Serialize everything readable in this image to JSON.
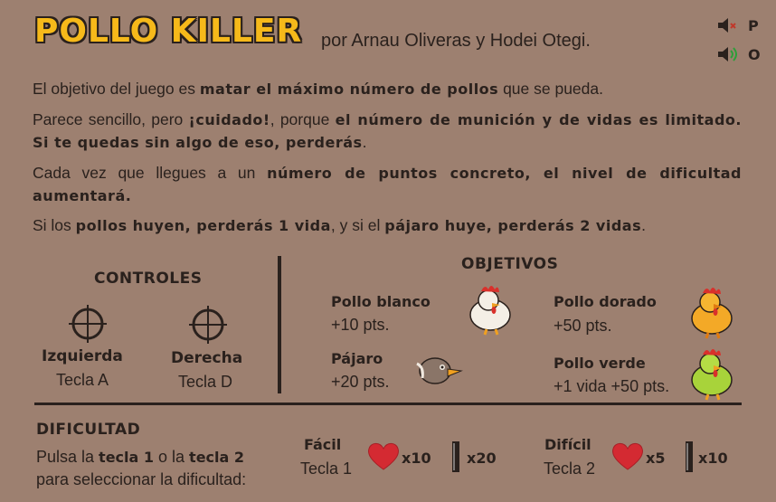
{
  "header": {
    "title": "POLLO KILLER",
    "byline": "por Arnau Oliveras y Hodei Otegi.",
    "mute_key": "P",
    "sound_key": "O"
  },
  "intro": {
    "p1": [
      {
        "text": "El objetivo del juego es ",
        "bold": false
      },
      {
        "text": "matar el máximo número de pollos",
        "bold": true
      },
      {
        "text": " que se pueda.",
        "bold": false
      }
    ],
    "p2": [
      {
        "text": "Parece sencillo, pero ",
        "bold": false
      },
      {
        "text": "¡cuidado!",
        "bold": true
      },
      {
        "text": ", porque ",
        "bold": false
      },
      {
        "text": "el número de munición y de vidas es limitado. Si te quedas sin algo de eso, perderás",
        "bold": true
      },
      {
        "text": ".",
        "bold": false
      }
    ],
    "p3": [
      {
        "text": "Cada vez que llegues a un ",
        "bold": false
      },
      {
        "text": "número de puntos concreto, el nivel de dificultad aumentará.",
        "bold": true
      }
    ],
    "p4": [
      {
        "text": "Si los ",
        "bold": false
      },
      {
        "text": "pollos huyen, perderás 1 vida",
        "bold": true
      },
      {
        "text": ", y si el ",
        "bold": false
      },
      {
        "text": "pájaro huye, perderás 2 vidas",
        "bold": true
      },
      {
        "text": ".",
        "bold": false
      }
    ]
  },
  "controls": {
    "heading": "CONTROLES",
    "left": {
      "label": "Izquierda",
      "key": "Tecla A"
    },
    "right": {
      "label": "Derecha",
      "key": "Tecla D"
    }
  },
  "objectives": {
    "heading": "OBJETIVOS",
    "white": {
      "name": "Pollo blanco",
      "points": "+10 pts."
    },
    "golden": {
      "name": "Pollo dorado",
      "points": "+50 pts."
    },
    "bird": {
      "name": "Pájaro",
      "points": "+20 pts."
    },
    "green": {
      "name": "Pollo verde",
      "points": "+1 vida +50 pts."
    }
  },
  "difficulty": {
    "heading": "DIFICULTAD",
    "instr_prefix": "Pulsa la ",
    "instr_key1": "tecla 1",
    "instr_mid": " o la ",
    "instr_key2": "tecla 2",
    "instr_line2": "para seleccionar la dificultad:",
    "easy": {
      "label": "Fácil",
      "key": "Tecla 1",
      "lives": "x10",
      "ammo": "x20"
    },
    "hard": {
      "label": "Difícil",
      "key": "Tecla 2",
      "lives": "x5",
      "ammo": "x10"
    }
  },
  "colors": {
    "background": "#9d8070",
    "title": "#f6b91a",
    "text": "#2a211d",
    "heart": "#d42a32"
  }
}
